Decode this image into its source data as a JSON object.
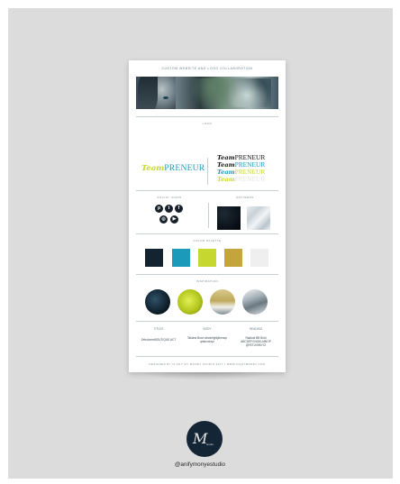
{
  "card": {
    "title": "CUSTOM WEBSITE AND LOGO COLLABORATION",
    "logo_section_label": "LOGO",
    "brand_script": "Team",
    "brand_word": "PRENEUR",
    "social_section_label": "SOCIAL ICONS",
    "patterns_section_label": "PATTERNS",
    "palette_section_label": "COLOR PALETTE",
    "inspiration_section_label": "INSPIRATION",
    "font_titles": [
      "TITLES",
      "BODY",
      "HEADING"
    ],
    "font_samples": [
      "ZebulonesBOUTIQUE ACT",
      "Tatiana Bush abcdefghijklmnop qrstuvwxyz",
      "Radical BB Bold ABCDEFGHIJKLMNOP QRSTUVWXYZ"
    ],
    "footer": "DESIGNED BY IF ANY MY MONEY STUDIO 2017 | WWW.IFANYMONEY.COM",
    "social_icons": [
      "pinterest-icon",
      "twitter-icon",
      "facebook-icon",
      "instagram-icon",
      "youtube-icon"
    ],
    "palette": [
      "#13232f",
      "#1b9ab9",
      "#c6d82f",
      "#c3a43d",
      "#efefef"
    ]
  },
  "studio": {
    "monogram": "M",
    "tagline": "studio",
    "handle": "@anifymonyestudio"
  }
}
